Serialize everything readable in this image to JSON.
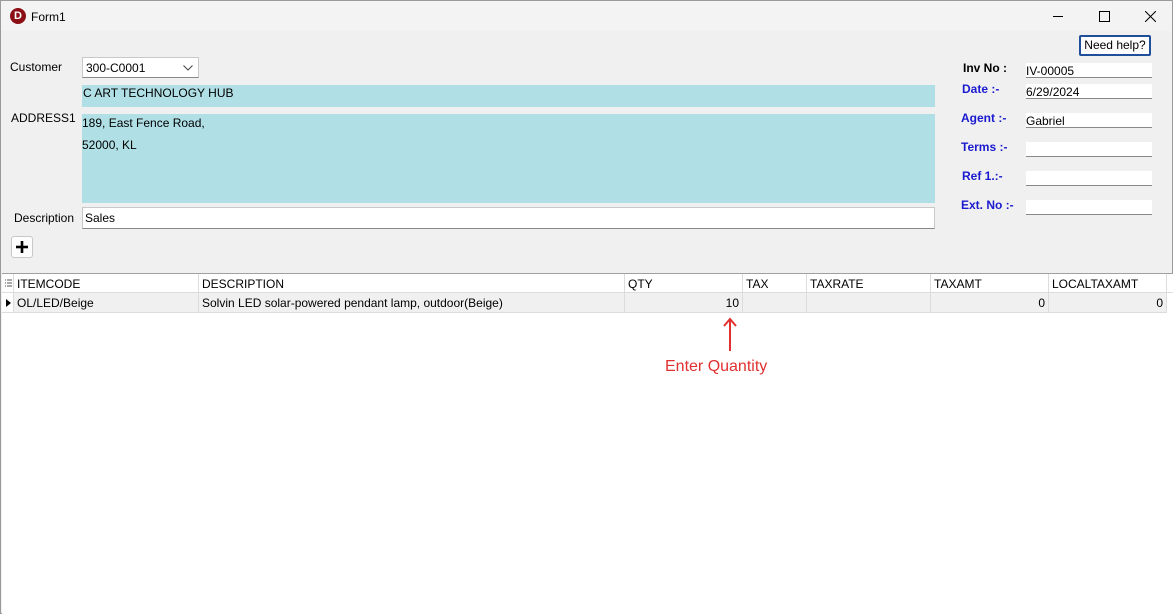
{
  "window": {
    "title": "Form1",
    "icon_letter": "D"
  },
  "header": {
    "customer_label": "Customer",
    "customer_value": "300-C0001",
    "company_name": "C ART TECHNOLOGY HUB",
    "address_label": "ADDRESS1",
    "address_lines": [
      "189, East Fence Road,",
      "52000, KL"
    ],
    "description_label": "Description",
    "description_value": "Sales",
    "help_label": "Need help?"
  },
  "invoice": {
    "inv_no_label": "Inv No :",
    "inv_no_value": "IV-00005",
    "date_label": "Date :-",
    "date_value": "6/29/2024",
    "agent_label": "Agent :-",
    "agent_value": "Gabriel",
    "terms_label": "Terms :-",
    "terms_value": "",
    "ref1_label": "Ref 1.:-",
    "ref1_value": "",
    "ext_label": "Ext. No :-",
    "ext_value": ""
  },
  "grid": {
    "columns": [
      "ITEMCODE",
      "DESCRIPTION",
      "QTY",
      "TAX",
      "TAXRATE",
      "TAXAMT",
      "LOCALTAXAMT"
    ],
    "rows": [
      {
        "itemcode": "OL/LED/Beige",
        "description": "Solvin LED solar-powered pendant lamp, outdoor(Beige)",
        "qty": "10",
        "tax": "",
        "taxrate": "",
        "taxamt": "0",
        "localtaxamt": "0"
      }
    ]
  },
  "annotation": {
    "text": "Enter Quantity",
    "color": "#e03030"
  }
}
